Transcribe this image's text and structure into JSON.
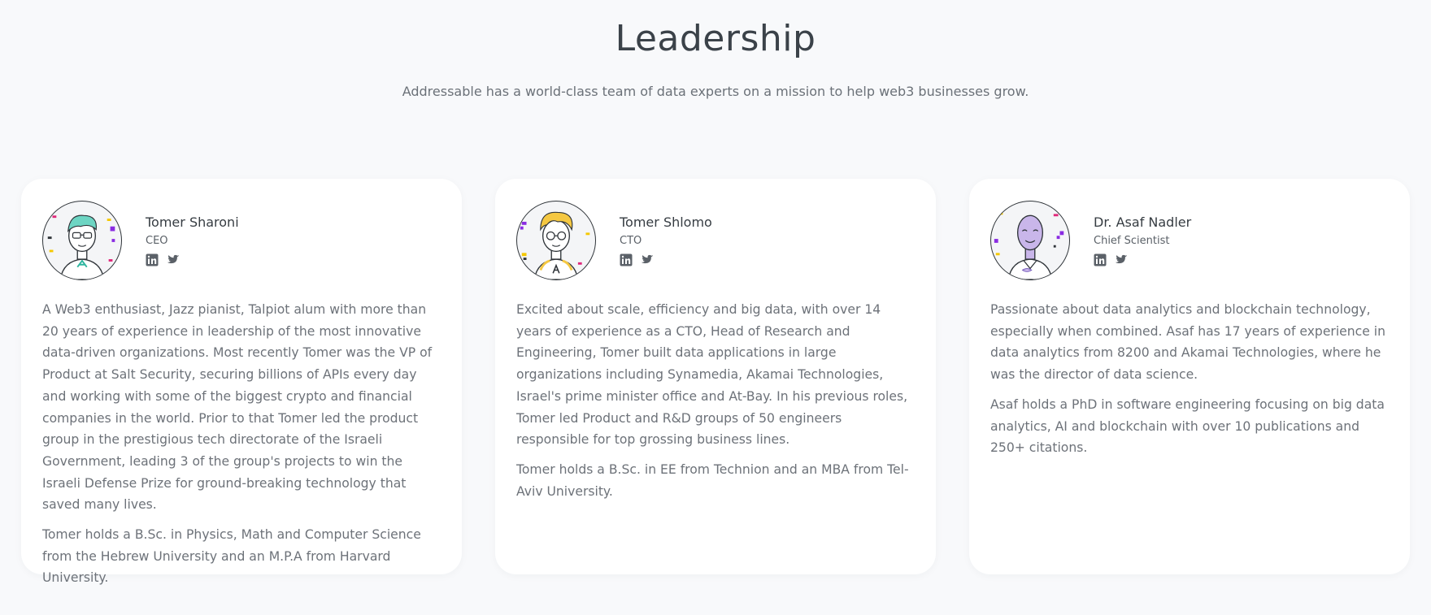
{
  "header": {
    "title": "Leadership",
    "subtitle": "Addressable has a world-class team of data experts on a mission to help web3 businesses grow."
  },
  "members": [
    {
      "name": "Tomer Sharoni",
      "role": "CEO",
      "avatar_hair_color": "#6dd5c3",
      "bio": [
        "A Web3 enthusiast, Jazz pianist, Talpiot alum with more than 20 years of experience in leadership of the most innovative data-driven organizations. Most recently Tomer was the VP of Product at Salt Security, securing billions of APIs every day and working with some of the biggest crypto and financial companies in the world. Prior to that Tomer led the product group in the prestigious tech directorate of the Israeli Government, leading 3 of the group's projects to win the Israeli Defense Prize for ground-breaking technology that saved many lives.",
        "Tomer holds a B.Sc. in Physics, Math and Computer Science from the Hebrew University and an M.P.A from Harvard University."
      ]
    },
    {
      "name": "Tomer Shlomo",
      "role": "CTO",
      "avatar_hair_color": "#f5c842",
      "bio": [
        "Excited about scale, efficiency and big data, with over 14 years of experience as a CTO, Head of Research and Engineering, Tomer built data applications in large organizations including Synamedia, Akamai Technologies, Israel's prime minister office and At-Bay. In his previous roles, Tomer led Product and R&D groups of 50 engineers responsible for top grossing business lines.",
        "Tomer holds a B.Sc. in EE from Technion and an MBA from Tel-Aviv University."
      ]
    },
    {
      "name": "Dr. Asaf Nadler",
      "role": "Chief Scientist",
      "avatar_hair_color": "#c9b6ea",
      "bio": [
        "Passionate about data analytics and blockchain technology, especially when combined. Asaf has 17 years of experience in data analytics from 8200 and Akamai Technologies, where he was the director of data science.",
        "Asaf holds a PhD in software engineering focusing on big data analytics, AI and blockchain with over 10 publications and 250+ citations."
      ]
    }
  ],
  "social_icons": [
    "linkedin-icon",
    "twitter-icon"
  ],
  "colors": {
    "background": "#f8f9fb",
    "card": "#ffffff",
    "text": "#3b4249",
    "muted": "#6d7279"
  }
}
